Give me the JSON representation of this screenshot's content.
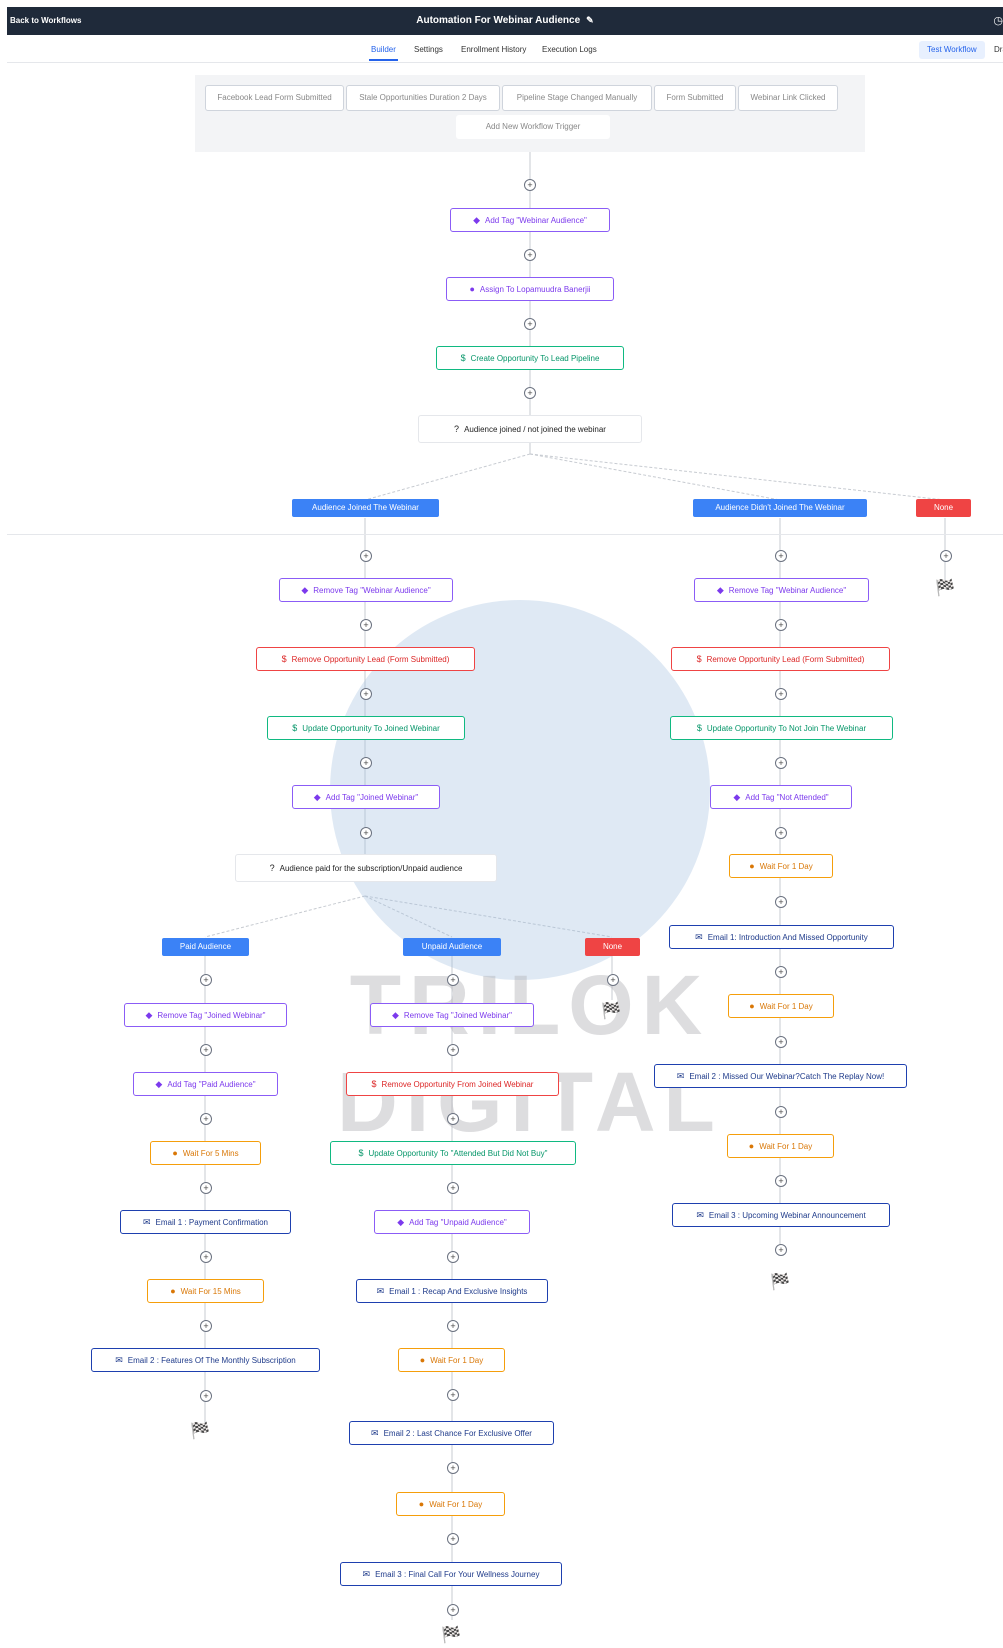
{
  "header": {
    "back": "Back to Workflows",
    "title": "Automation For Webinar Audience",
    "edit_icon": "pencil-icon",
    "clock_icon": "clock-icon"
  },
  "tabs": [
    "Builder",
    "Settings",
    "Enrollment History",
    "Execution Logs"
  ],
  "actions": {
    "test": "Test Workflow",
    "draft": "Draf"
  },
  "triggers": [
    "Facebook Lead Form Submitted",
    "Stale Opportunities Duration 2 Days",
    "Pipeline Stage Changed Manually",
    "Form Submitted",
    "Webinar Link Clicked"
  ],
  "add_trigger": "Add New Workflow Trigger",
  "main": [
    "Add Tag \"Webinar Audience\"",
    "Assign To Lopamuudra Banerjii",
    "Create Opportunity To Lead Pipeline"
  ],
  "condition1": "Audience joined / not joined the webinar",
  "branches1": [
    "Audience Joined The Webinar",
    "Audience Didn't Joined The Webinar",
    "None"
  ],
  "joined": [
    "Remove Tag \"Webinar Audience\"",
    "Remove Opportunity Lead (Form Submitted)",
    "Update Opportunity To Joined Webinar",
    "Add Tag \"Joined Webinar\""
  ],
  "condition2": "Audience paid for the subscription/Unpaid audience",
  "branches2": [
    "Paid Audience",
    "Unpaid Audience",
    "None"
  ],
  "paid": [
    "Remove Tag \"Joined Webinar\"",
    "Add Tag \"Paid Audience\"",
    "Wait For 5 Mins",
    "Email 1 : Payment Confirmation",
    "Wait For 15 Mins",
    "Email 2 : Features Of The Monthly Subscription"
  ],
  "unpaid": [
    "Remove Tag \"Joined Webinar\"",
    "Remove Opportunity From Joined Webinar",
    "Update Opportunity To \"Attended But Did Not Buy\"",
    "Add Tag \"Unpaid Audience\"",
    "Email 1 : Recap And Exclusive Insights",
    "Wait For 1 Day",
    "Email 2 : Last Chance For Exclusive Offer",
    "Wait For 1 Day",
    "Email 3 : Final Call For Your Wellness Journey"
  ],
  "notjoined": [
    "Remove Tag \"Webinar Audience\"",
    "Remove Opportunity Lead (Form Submitted)",
    "Update Opportunity To Not Join The Webinar",
    "Add Tag \"Not Attended\"",
    "Wait For 1 Day",
    "Email 1: Introduction And Missed Opportunity",
    "Wait For 1 Day",
    "Email 2 : Missed Our Webinar?Catch The Replay Now!",
    "Wait For 1 Day",
    "Email 3 : Upcoming Webinar Announcement"
  ],
  "watermark": "TRILOK DIGITAL",
  "colors": {
    "purple": "#8b5cf6",
    "green": "#10b981",
    "red": "#ef4444",
    "orange": "#f59e0b",
    "blue": "#1e40af",
    "branch_blue": "#3b82f6"
  },
  "icons": {
    "tag": "tag-icon",
    "user": "user-icon",
    "dollar": "dollar-icon",
    "remove_tag": "remove-tag-icon",
    "remove_opp": "remove-opportunity-icon",
    "update_opp": "update-opportunity-icon",
    "wait": "clock-icon",
    "email": "email-icon",
    "condition": "question-icon",
    "end": "finish-flag-icon"
  }
}
